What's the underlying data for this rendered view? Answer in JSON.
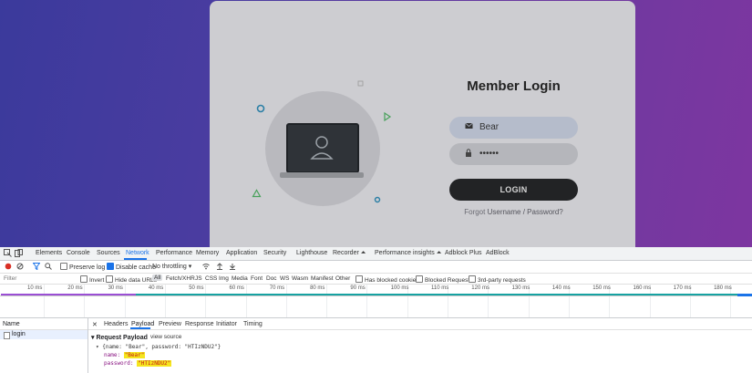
{
  "webpage": {
    "title": "Member Login",
    "username_value": "Bear",
    "password_value": "••••••",
    "login_button": "LOGIN",
    "forgot_prefix": "Forgot",
    "forgot_link": "Username / Password?"
  },
  "devtools": {
    "tabs": [
      "Elements",
      "Console",
      "Sources",
      "Network",
      "Performance",
      "Memory",
      "Application",
      "Security",
      "Lighthouse",
      "Recorder ⏶",
      "Performance insights ⏶",
      "Adblock Plus",
      "AdBlock"
    ],
    "active_tab": "Network",
    "toolbar": {
      "preserve_log": "Preserve log",
      "disable_cache": "Disable cache",
      "throttling": "No throttling"
    },
    "filter": {
      "placeholder": "Filter",
      "invert": "Invert",
      "hide_data_urls": "Hide data URLs",
      "types": [
        "All",
        "Fetch/XHR",
        "JS",
        "CSS",
        "Img",
        "Media",
        "Font",
        "Doc",
        "WS",
        "Wasm",
        "Manifest",
        "Other"
      ],
      "has_blocked_cookies": "Has blocked cookies",
      "blocked_requests": "Blocked Requests",
      "third_party": "3rd-party requests"
    },
    "timeline_ticks": [
      "10 ms",
      "20 ms",
      "30 ms",
      "40 ms",
      "50 ms",
      "60 ms",
      "70 ms",
      "80 ms",
      "90 ms",
      "100 ms",
      "110 ms",
      "120 ms",
      "130 ms",
      "140 ms",
      "150 ms",
      "160 ms",
      "170 ms",
      "180 ms",
      "19"
    ],
    "request_list": {
      "header": "Name",
      "rows": [
        "login"
      ]
    },
    "detail_tabs": [
      "Headers",
      "Payload",
      "Preview",
      "Response",
      "Initiator",
      "Timing"
    ],
    "payload": {
      "section": "Request Payload",
      "view_source": "view source",
      "summary": "{name: \"Bear\", password: \"HTIzNDU2\"}",
      "name_key": "name:",
      "name_val": "\"Bear\"",
      "password_key": "password:",
      "password_val": "\"HTIzNDU2\""
    }
  }
}
